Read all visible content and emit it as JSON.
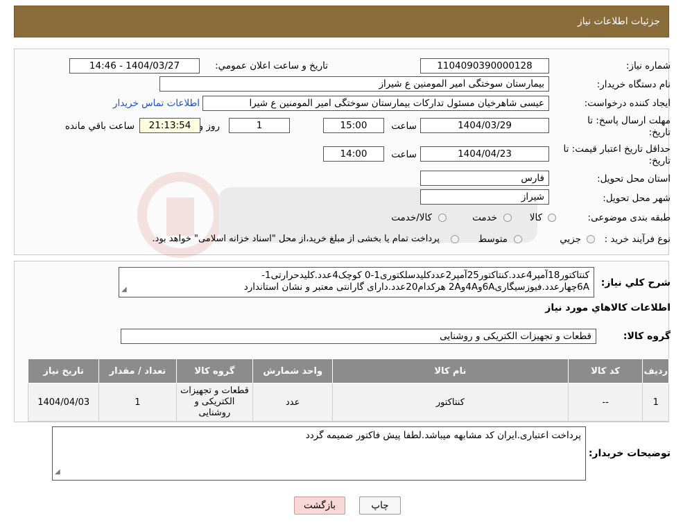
{
  "header": {
    "title": "جزئیات اطلاعات نیاز"
  },
  "general": {
    "need_number_label": "شماره نیاز:",
    "need_number": "1104090390000128",
    "announce_label": "تاریخ و ساعت اعلان عمومي:",
    "announce_value": "1404/03/27 - 14:46",
    "buyer_org_label": "نام دستگاه خريدار:",
    "buyer_org": "بیمارستان سوختگی امیر المومنین  ع  شیراز",
    "requester_label": "ايجاد کننده درخواست:",
    "requester": "عیسی  شاهرخیان مسئول تدارکات بیمارستان سوختگی امیر المومنین  ع  شیرا",
    "contact_link": "اطلاعات تماس خریدار",
    "deadline_label_1": "مهلت ارسال پاسخ: تا",
    "deadline_label_2": "تاريخ:",
    "deadline_date": "1404/03/29",
    "time_label": "ساعت",
    "deadline_time": "15:00",
    "days_value": "1",
    "days_label": "روز و",
    "remaining_time": "21:13:54",
    "remaining_label": "ساعت باقي مانده",
    "validity_label_1": "حداقل تاريخ اعتبار قيمت: تا",
    "validity_label_2": "تاريخ:",
    "validity_date": "1404/04/23",
    "validity_time": "14:00",
    "province_label": "استان محل تحويل:",
    "province": "فارس",
    "city_label": "شهر محل تحويل:",
    "city": "شیراز",
    "category_label": "طبقه بندی موضوعی:",
    "category_options": [
      "کالا",
      "خدمت",
      "کالا/خدمت"
    ],
    "process_label": "نوع فرآيند خريد :",
    "process_options": [
      "جزيي",
      "متوسط"
    ],
    "process_note": "پرداخت تمام يا بخشی از مبلغ خريد،از محل \"اسناد خزانه اسلامی\" خواهد بود."
  },
  "description": {
    "label": "شرح کلي نياز:",
    "line1": "کنتاکتور18آمپر4عدد.کنتاکتور25آمپر2عددکلیدسلکتوری1-0 کوچک4عدد.کلیدحرارتی1-",
    "line2": "6Aچهارعدد.فیوزسیگاری6Aو4Aو2A هرکدام20عدد.دارای گارانتی معتبر و نشان استاندارد"
  },
  "items_section": {
    "title": "اطلاعات کالاهاي مورد نياز",
    "group_label": "گروه کالا:",
    "group_value": "قطعات و تجهیزات الکتریکی و روشنایی",
    "columns": [
      "رديف",
      "کد کالا",
      "نام کالا",
      "واحد شمارش",
      "گروه کالا",
      "تعداد / مقدار",
      "تاريخ نياز"
    ],
    "rows": [
      {
        "row": "1",
        "code": "--",
        "name": "کنتاکتور",
        "unit": "عدد",
        "group_l1": "قطعات و تجهیزات",
        "group_l2": "الکتریکی و",
        "group_l3": "روشنایی",
        "qty": "1",
        "date": "1404/04/03"
      }
    ]
  },
  "buyer_notes": {
    "label": "توضیحات خریدار:",
    "text": "پرداخت اعتباری.ایران کد مشابهه میباشد.لطفا پیش فاکتور ضمیمه گردد"
  },
  "buttons": {
    "print": "چاپ",
    "back": "بازگشت"
  },
  "colors": {
    "header_bg": "#8a6d3b",
    "table_header_bg": "#8c8c8c",
    "link": "#1a4fd0",
    "back_button_bg": "#f8d7d7"
  }
}
